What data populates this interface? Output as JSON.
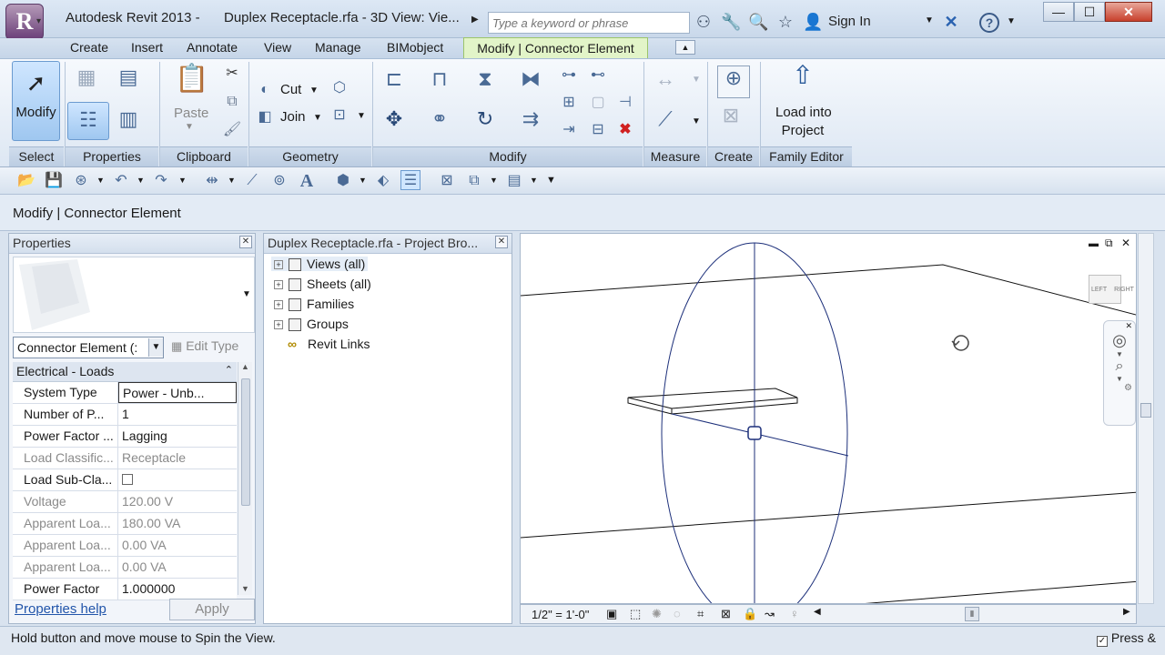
{
  "titlebar": {
    "app_button": "R",
    "app_title": "Autodesk Revit 2013 -",
    "doc_title": "Duplex Receptacle.rfa - 3D View: Vie...",
    "search_placeholder": "Type a keyword or phrase",
    "sign_in": "Sign In",
    "help": "?"
  },
  "tabs": [
    "Create",
    "Insert",
    "Annotate",
    "View",
    "Manage",
    "BIMobject"
  ],
  "active_tab": "Modify | Connector Element",
  "ribbon": {
    "modify_label": "Modify",
    "paste_label": "Paste",
    "cut_label": "Cut",
    "join_label": "Join",
    "load_line1": "Load into",
    "load_line2": "Project",
    "panels": {
      "select": "Select",
      "properties": "Properties",
      "clipboard": "Clipboard",
      "geometry": "Geometry",
      "modify": "Modify",
      "measure": "Measure",
      "create": "Create",
      "family_editor": "Family Editor"
    }
  },
  "context_label": "Modify | Connector Element",
  "properties": {
    "title": "Properties",
    "type_selector": "Connector Element (:",
    "edit_type": "Edit Type",
    "group": "Electrical - Loads",
    "rows": [
      {
        "label": "System Type",
        "value": "Power - Unb..."
      },
      {
        "label": "Number of P...",
        "value": "1"
      },
      {
        "label": "Power Factor ...",
        "value": "Lagging"
      },
      {
        "label": "Load Classific...",
        "value": "Receptacle"
      },
      {
        "label": "Load Sub-Cla...",
        "value": ""
      },
      {
        "label": "Voltage",
        "value": "120.00 V"
      },
      {
        "label": "Apparent Loa...",
        "value": "180.00 VA"
      },
      {
        "label": "Apparent Loa...",
        "value": "0.00 VA"
      },
      {
        "label": "Apparent Loa...",
        "value": "0.00 VA"
      },
      {
        "label": "Power Factor",
        "value": "1.000000"
      }
    ],
    "help_link": "Properties help",
    "apply": "Apply"
  },
  "browser": {
    "title": "Duplex Receptacle.rfa - Project Bro...",
    "items": [
      "Views (all)",
      "Sheets (all)",
      "Families",
      "Groups",
      "Revit Links"
    ]
  },
  "viewcube": {
    "left": "LEFT",
    "right": "RIGHT"
  },
  "view_control": {
    "scale": "1/2\" = 1'-0\""
  },
  "status": {
    "text": "Hold button and move mouse to Spin the View.",
    "press_drag": "Press &"
  }
}
